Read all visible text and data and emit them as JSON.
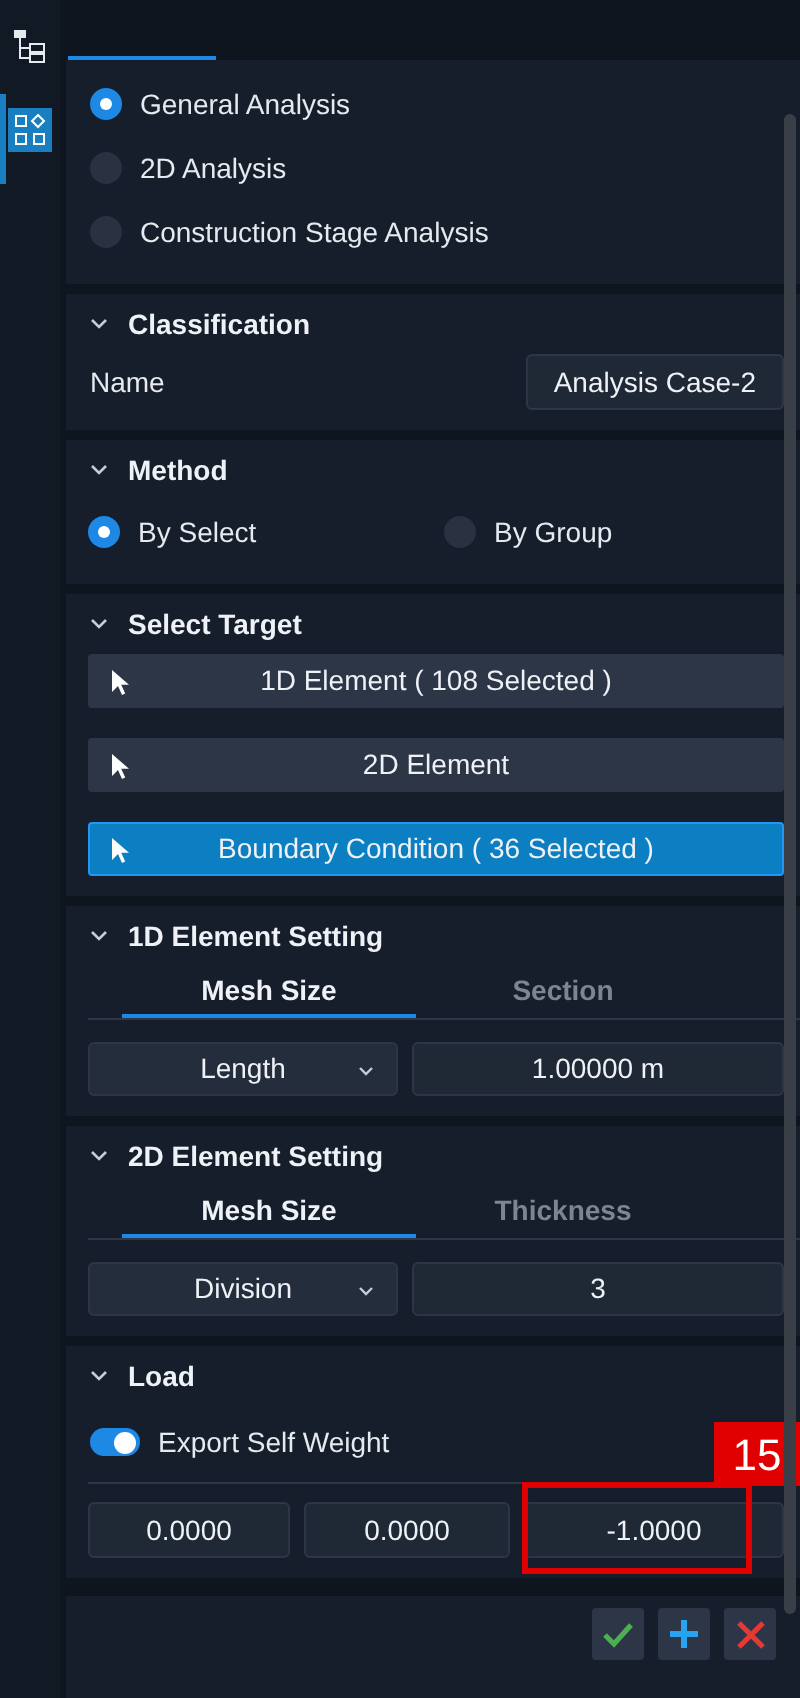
{
  "analysis_types": [
    {
      "label": "General Analysis",
      "selected": true
    },
    {
      "label": "2D Analysis",
      "selected": false
    },
    {
      "label": "Construction Stage Analysis",
      "selected": false
    }
  ],
  "classification": {
    "title": "Classification",
    "name_label": "Name",
    "name_value": "Analysis Case-2"
  },
  "method": {
    "title": "Method",
    "options": [
      {
        "label": "By Select",
        "selected": true
      },
      {
        "label": "By Group",
        "selected": false
      }
    ]
  },
  "select_target": {
    "title": "Select Target",
    "buttons": [
      {
        "label": "1D Element ( 108 Selected )",
        "selected": false
      },
      {
        "label": "2D Element",
        "selected": false
      },
      {
        "label": "Boundary Condition ( 36 Selected )",
        "selected": true
      }
    ]
  },
  "element_settings": [
    {
      "title": "1D Element Setting",
      "tabs": [
        {
          "label": "Mesh Size",
          "selected": true
        },
        {
          "label": "Section",
          "selected": false
        }
      ],
      "dropdown": "Length",
      "value": "1.00000 m"
    },
    {
      "title": "2D Element Setting",
      "tabs": [
        {
          "label": "Mesh Size",
          "selected": true
        },
        {
          "label": "Thickness",
          "selected": false
        }
      ],
      "dropdown": "Division",
      "value": "3"
    }
  ],
  "load": {
    "title": "Load",
    "toggle": {
      "label": "Export Self Weight",
      "on": true
    },
    "fields": [
      "0.0000",
      "0.0000",
      "-1.0000"
    ]
  },
  "actions": [
    {
      "kind": "confirm"
    },
    {
      "kind": "add"
    },
    {
      "kind": "cancel"
    }
  ],
  "annotation": {
    "label": "15"
  }
}
